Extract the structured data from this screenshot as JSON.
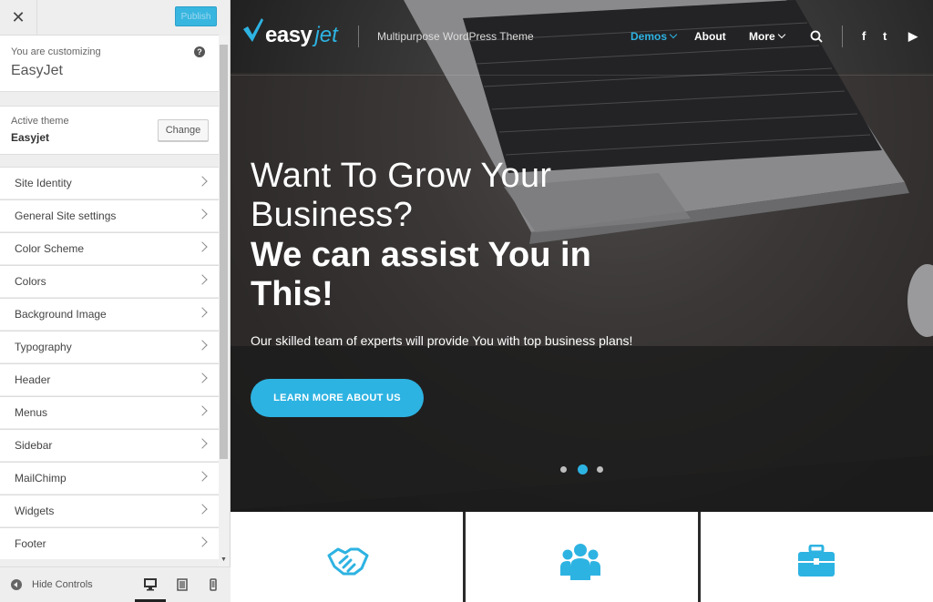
{
  "sidebar": {
    "close_glyph": "✕",
    "publish_label": "Publish",
    "customizing_label": "You are customizing",
    "customizing_title": "EasyJet",
    "help_glyph": "?",
    "active_theme_label": "Active theme",
    "active_theme_name": "Easyjet",
    "change_label": "Change",
    "items": [
      {
        "label": "Site Identity"
      },
      {
        "label": "General Site settings"
      },
      {
        "label": "Color Scheme"
      },
      {
        "label": "Colors"
      },
      {
        "label": "Background Image"
      },
      {
        "label": "Typography"
      },
      {
        "label": "Header"
      },
      {
        "label": "Menus"
      },
      {
        "label": "Sidebar"
      },
      {
        "label": "MailChimp"
      },
      {
        "label": "Widgets"
      },
      {
        "label": "Footer"
      }
    ],
    "hide_controls_label": "Hide Controls",
    "devices": [
      "desktop-icon",
      "tablet-icon",
      "mobile-icon"
    ],
    "active_device": "desktop"
  },
  "preview": {
    "logo": {
      "easy": "easy",
      "jet": "jet"
    },
    "tagline": "Multipurpose WordPress Theme",
    "nav": {
      "demos": "Demos",
      "about": "About",
      "more": "More"
    },
    "social": {
      "facebook": "f",
      "twitter": "t",
      "youtube": "▶"
    },
    "hero": {
      "headline_light": "Want To Grow Your Business?",
      "headline_bold": "We can assist You in This!",
      "subtitle": "Our skilled team of experts will provide You with top business plans!",
      "cta": "LEARN MORE ABOUT US"
    },
    "slider": {
      "count": 3,
      "active_index": 1
    },
    "feature_icons": [
      "handshake-icon",
      "team-icon",
      "briefcase-icon"
    ]
  },
  "colors": {
    "accent": "#2db3e2",
    "sidebar_bg": "#eeeeee",
    "hero_bg": "#2b2b2b"
  }
}
